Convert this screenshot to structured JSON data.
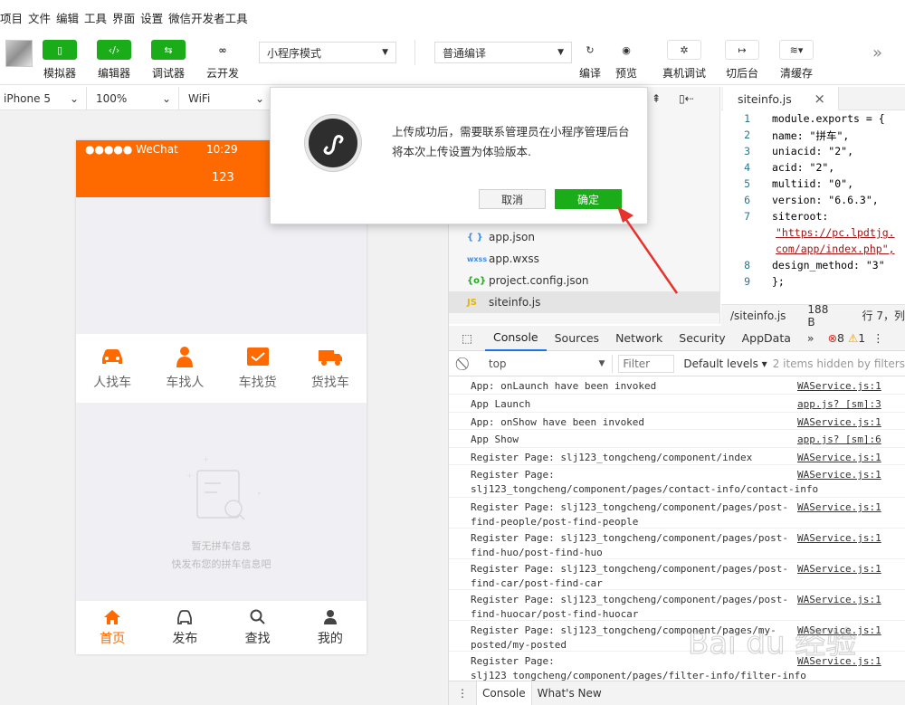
{
  "menu": [
    "项目",
    "文件",
    "编辑",
    "工具",
    "界面",
    "设置",
    "微信开发者工具"
  ],
  "toolbar": {
    "simulator": "模拟器",
    "editor": "编辑器",
    "debugger": "调试器",
    "cloud": "云开发",
    "mode_select": "小程序模式",
    "compile_select": "普通编译",
    "compile": "编译",
    "preview": "预览",
    "device_debug": "真机调试",
    "background": "切后台",
    "clear_cache": "清缓存",
    "more": "»"
  },
  "devicebar": {
    "device": "iPhone 5",
    "zoom": "100%",
    "network": "WiFi"
  },
  "phone": {
    "status_left": "●●●●● WeChat",
    "time": "10:29",
    "nav_title": "123",
    "tabs": [
      "人找车",
      "车找人",
      "车找货",
      "货找车"
    ],
    "empty_line1": "暂无拼车信息",
    "empty_line2": "快发布您的拼车信息吧",
    "bottom_nav": [
      "首页",
      "发布",
      "查找",
      "我的"
    ]
  },
  "files": [
    {
      "icon": "{ }",
      "name": "app.json"
    },
    {
      "icon": "wxss",
      "name": "app.wxss"
    },
    {
      "icon": "{o}",
      "name": "project.config.json"
    },
    {
      "icon": "JS",
      "name": "siteinfo.js"
    }
  ],
  "code_tab": {
    "name": "siteinfo.js",
    "close": "×"
  },
  "code_lines": [
    {
      "n": "1",
      "t": "module.exports = {"
    },
    {
      "n": "2",
      "t": "    name: \"拼车\","
    },
    {
      "n": "3",
      "t": "    uniacid: \"2\","
    },
    {
      "n": "4",
      "t": "    acid: \"2\","
    },
    {
      "n": "5",
      "t": "    multiid: \"0\","
    },
    {
      "n": "6",
      "t": "    version: \"6.6.3\","
    },
    {
      "n": "7",
      "t": "  siteroot:"
    },
    {
      "n": "",
      "t": "\"https://pc.lpdtjg."
    },
    {
      "n": "",
      "t": "com/app/index.php\","
    },
    {
      "n": "8",
      "t": "    design_method: \"3\""
    },
    {
      "n": "9",
      "t": "};"
    }
  ],
  "code_status": {
    "path": "/siteinfo.js",
    "size": "188 B",
    "position": "行 7，列"
  },
  "devtools": {
    "tabs": [
      "Console",
      "Sources",
      "Network",
      "Security",
      "AppData",
      "»"
    ],
    "errors": "8",
    "warnings": "1",
    "context": "top",
    "filter_placeholder": "Filter",
    "levels": "Default levels ▾",
    "hidden": "2 items hidden by filters"
  },
  "console_logs": [
    {
      "msg": "App: onLaunch have been invoked",
      "src": "WAService.js:1"
    },
    {
      "msg": "App Launch",
      "src": "app.js? [sm]:3"
    },
    {
      "msg": "App: onShow have been invoked",
      "src": "WAService.js:1"
    },
    {
      "msg": "App Show",
      "src": "app.js? [sm]:6"
    },
    {
      "msg": "Register Page: slj123_tongcheng/component/index",
      "src": "WAService.js:1"
    },
    {
      "msg": "Register Page:\nslj123_tongcheng/component/pages/contact-info/contact-info",
      "src": "WAService.js:1"
    },
    {
      "msg": "Register Page: slj123_tongcheng/component/pages/post-\nfind-people/post-find-people",
      "src": "WAService.js:1"
    },
    {
      "msg": "Register Page: slj123_tongcheng/component/pages/post-\nfind-huo/post-find-huo",
      "src": "WAService.js:1"
    },
    {
      "msg": "Register Page: slj123_tongcheng/component/pages/post-\nfind-car/post-find-car",
      "src": "WAService.js:1"
    },
    {
      "msg": "Register Page: slj123_tongcheng/component/pages/post-\nfind-huocar/post-find-huocar",
      "src": "WAService.js:1"
    },
    {
      "msg": "Register Page: slj123_tongcheng/component/pages/my-\nposted/my-posted",
      "src": "WAService.js:1"
    },
    {
      "msg": "Register Page:\nslj123_tongcheng/component/pages/filter-info/filter-info",
      "src": "WAService.js:1"
    }
  ],
  "drawer": {
    "console": "Console",
    "whats_new": "What's New"
  },
  "modal": {
    "text": "上传成功后，需要联系管理员在小程序管理后台将本次上传设置为体验版本.",
    "cancel": "取消",
    "confirm": "确定"
  },
  "colors": {
    "accent_green": "#1aad19",
    "phone_orange": "#ff6a00",
    "arrow_red": "#e8322d"
  },
  "watermark": "Bai du 经验"
}
